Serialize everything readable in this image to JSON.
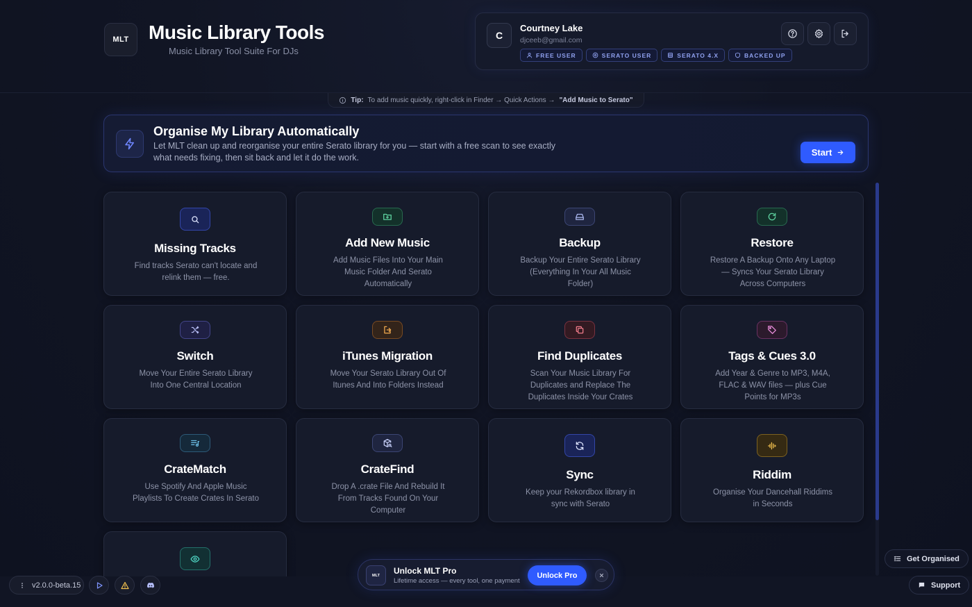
{
  "header": {
    "logo": "MLT",
    "title": "Music Library Tools",
    "subtitle": "Music Library Tool Suite For DJs"
  },
  "user": {
    "initial": "C",
    "name": "Courtney Lake",
    "email": "djceeb@gmail.com",
    "badges": [
      "FREE USER",
      "SERATO USER",
      "SERATO 4.X",
      "BACKED UP"
    ]
  },
  "tip": {
    "label": "Tip:",
    "text": "To add music quickly, right-click in Finder → Quick Actions →",
    "emphasis": "\"Add Music to Serato\""
  },
  "banner": {
    "title": "Organise My Library Automatically",
    "description": "Let MLT clean up and reorganise your entire Serato library for you — start with a free scan to see exactly what needs fixing, then sit back and let it do the work.",
    "button": "Start"
  },
  "tools": [
    {
      "title": "Missing Tracks",
      "description": "Find tracks Serato can't locate and relink them — free.",
      "icon": "search-icon"
    },
    {
      "title": "Add New Music",
      "description": "Add Music Files Into Your Main Music Folder And Serato Automatically",
      "icon": "folder-plus-icon"
    },
    {
      "title": "Backup",
      "description": "Backup Your Entire Serato Library (Everything In Your All Music Folder)",
      "icon": "hard-drive-icon"
    },
    {
      "title": "Restore",
      "description": "Restore A Backup Onto Any Laptop — Syncs Your Serato Library Across Computers",
      "icon": "rotate-icon"
    },
    {
      "title": "Switch",
      "description": "Move Your Entire Serato Library Into One Central Location",
      "icon": "shuffle-icon"
    },
    {
      "title": "iTunes Migration",
      "description": "Move Your Serato Library Out Of Itunes And Into Folders Instead",
      "icon": "export-icon"
    },
    {
      "title": "Find Duplicates",
      "description": "Scan Your Music Library For Duplicates and Replace The Duplicates Inside Your Crates",
      "icon": "copy-icon"
    },
    {
      "title": "Tags & Cues 3.0",
      "description": "Add Year & Genre to MP3, M4A, FLAC & WAV files — plus Cue Points for MP3s",
      "icon": "tag-icon"
    },
    {
      "title": "CrateMatch",
      "description": "Use Spotify And Apple Music Playlists To Create Crates In Serato",
      "icon": "playlist-icon"
    },
    {
      "title": "CrateFind",
      "description": "Drop A .crate File And Rebuild It From Tracks Found On Your Computer",
      "icon": "package-search-icon"
    },
    {
      "title": "Sync",
      "description": "Keep your Rekordbox library in sync with Serato",
      "icon": "refresh-icon"
    },
    {
      "title": "Riddim",
      "description": "Organise Your Dancehall Riddims in Seconds",
      "icon": "audio-wave-icon"
    },
    {
      "title": "",
      "description": "",
      "icon": "eye-icon"
    }
  ],
  "footer": {
    "version": "v2.0.0-beta.15",
    "promo_logo": "MLT",
    "promo_title": "Unlock MLT Pro",
    "promo_subtitle": "Lifetime access — every tool, one payment",
    "promo_button": "Unlock Pro",
    "get_organised": "Get Organised",
    "support": "Support"
  }
}
